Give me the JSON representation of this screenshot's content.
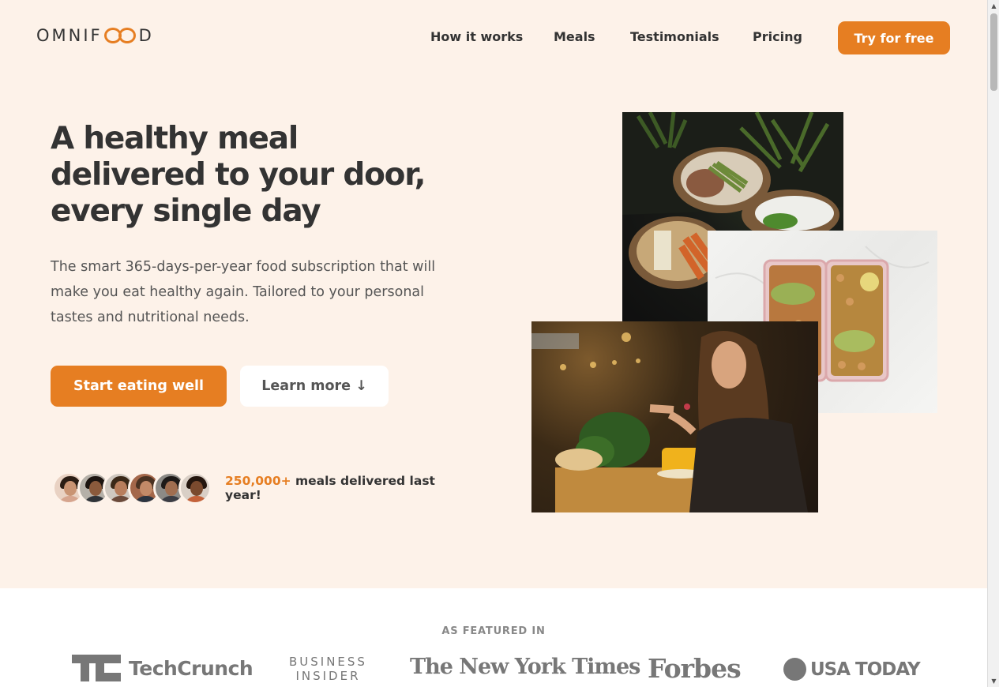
{
  "header": {
    "logo_left": "OMNIF",
    "logo_right": "D",
    "nav": [
      "How it works",
      "Meals",
      "Testimonials",
      "Pricing"
    ],
    "cta_label": "Try for free"
  },
  "hero": {
    "title": "A healthy meal delivered to your door, every single day",
    "description": "The smart 365-days-per-year food subscription that will make you eat healthy again. Tailored to your personal tastes and nutritional needs.",
    "primary_button": "Start eating well",
    "secondary_button": "Learn more ↓",
    "delivered_count": "250,000+",
    "delivered_text": " meals delivered last year!"
  },
  "featured": {
    "label": "AS FEATURED IN",
    "logos": {
      "techcrunch": "TechCrunch",
      "business_insider_line1": "BUSINESS",
      "business_insider_line2": "INSIDER",
      "nyt": "The New York Times",
      "forbes": "Forbes",
      "usa_today": "USA TODAY"
    }
  },
  "icons": [
    "logo-infinity-icon",
    "scroll-up-arrow-icon",
    "scroll-down-arrow-icon"
  ],
  "colors": {
    "accent": "#e67e22",
    "hero_bg": "#fdf2e9",
    "text": "#333333"
  }
}
